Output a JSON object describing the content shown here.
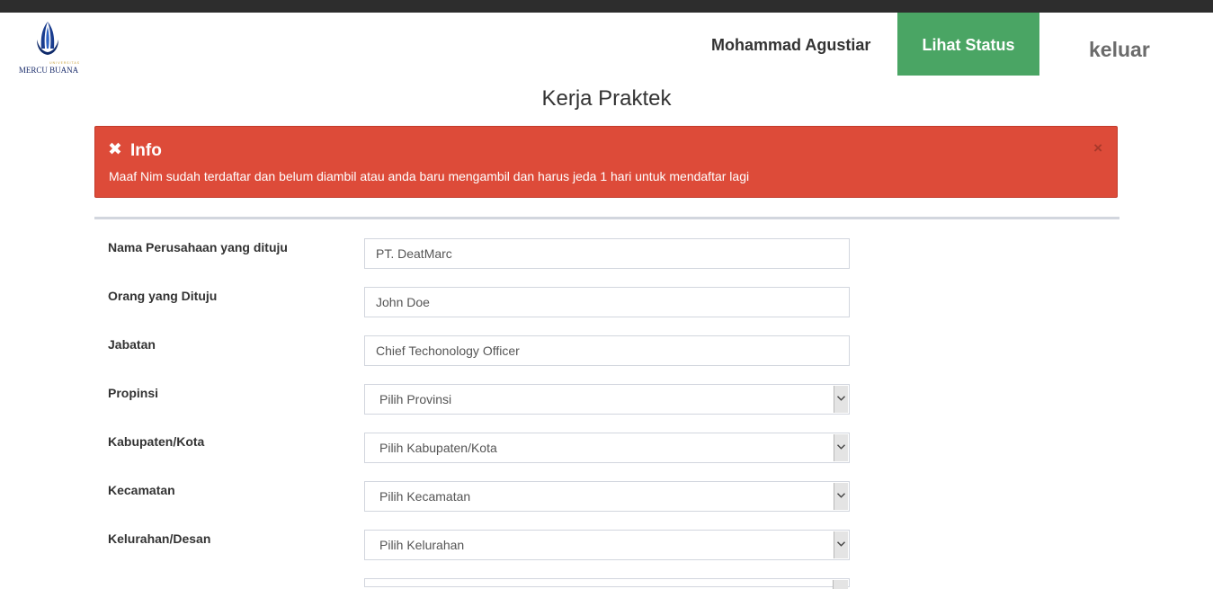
{
  "header": {
    "logo_text": "MERCU BUANA",
    "logo_subtext": "UNIVERSITAS",
    "username": "Mohammad Agustiar",
    "status_button": "Lihat Status",
    "logout_label": "keluar",
    "status_button_color": "#4aa564"
  },
  "page": {
    "title": "Kerja Praktek"
  },
  "alert": {
    "title": "Info",
    "message": "Maaf Nim sudah terdaftar dan belum diambil atau anda baru mengambil dan harus jeda 1 hari untuk mendaftar lagi",
    "close": "×",
    "icon": "✖",
    "color": "#dd4b39"
  },
  "form": {
    "company_label": "Nama Perusahaan yang dituju",
    "company_value": "PT. DeatMarc",
    "person_label": "Orang yang Dituju",
    "person_value": "John Doe",
    "position_label": "Jabatan",
    "position_value": "Chief Techonology Officer",
    "province_label": "Propinsi",
    "province_value": "Pilih Provinsi",
    "city_label": "Kabupaten/Kota",
    "city_value": "Pilih Kabupaten/Kota",
    "district_label": "Kecamatan",
    "district_value": "Pilih Kecamatan",
    "village_label": "Kelurahan/Desan",
    "village_value": "Pilih Kelurahan"
  }
}
